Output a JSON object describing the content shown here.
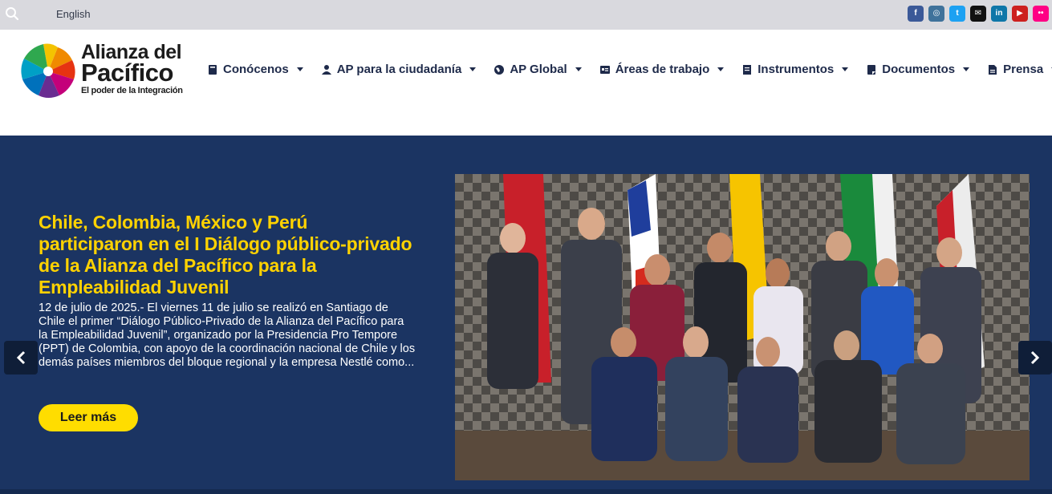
{
  "topbar": {
    "language_link": "English",
    "social_icons": [
      {
        "name": "facebook-icon",
        "glyph": "f",
        "color": "#3b5998"
      },
      {
        "name": "instagram-icon",
        "glyph": "◎",
        "color": "#3f729b"
      },
      {
        "name": "twitter-icon",
        "glyph": "t",
        "color": "#1da1f2"
      },
      {
        "name": "mail-icon",
        "glyph": "✉",
        "color": "#111111"
      },
      {
        "name": "linkedin-icon",
        "glyph": "in",
        "color": "#0e76a8"
      },
      {
        "name": "youtube-icon",
        "glyph": "▶",
        "color": "#cd201f"
      },
      {
        "name": "flickr-icon",
        "glyph": "••",
        "color": "#ff0084"
      }
    ]
  },
  "logo": {
    "line1": "Alianza del",
    "line2": "Pacífico",
    "tagline": "El poder de la Integración"
  },
  "nav": {
    "items": [
      {
        "label": "Conócenos",
        "icon": "book-icon"
      },
      {
        "label": "AP para la ciudadanía",
        "icon": "user-icon"
      },
      {
        "label": "AP Global",
        "icon": "globe-icon"
      },
      {
        "label": "Áreas de trabajo",
        "icon": "id-card-icon"
      },
      {
        "label": "Instrumentos",
        "icon": "document-icon"
      },
      {
        "label": "Documentos",
        "icon": "notebook-icon"
      },
      {
        "label": "Prensa",
        "icon": "file-icon"
      }
    ]
  },
  "hero": {
    "title": "Chile, Colombia, México y Perú participaron en el I Diálogo público-privado de la Alianza del Pacífico para la Empleabilidad Juvenil",
    "excerpt": "12 de julio de 2025.- El viernes 11 de julio se realizó en Santiago de Chile el primer “Diálogo Público-Privado de la Alianza del Pacífico para la Empleabilidad Juvenil”, organizado por la Presidencia Pro Tempore (PPT) de Colombia, con apoyo de la coordinación nacional de Chile y los demás países miembros del bloque regional y la empresa Nestlé como...",
    "button_label": "Leer más"
  },
  "colors": {
    "topbar_bg": "#d9d9de",
    "hero_bg": "#1b3462",
    "title_yellow": "#ffd200",
    "button_yellow": "#ffdd00",
    "nav_text": "#1e2a4a"
  }
}
